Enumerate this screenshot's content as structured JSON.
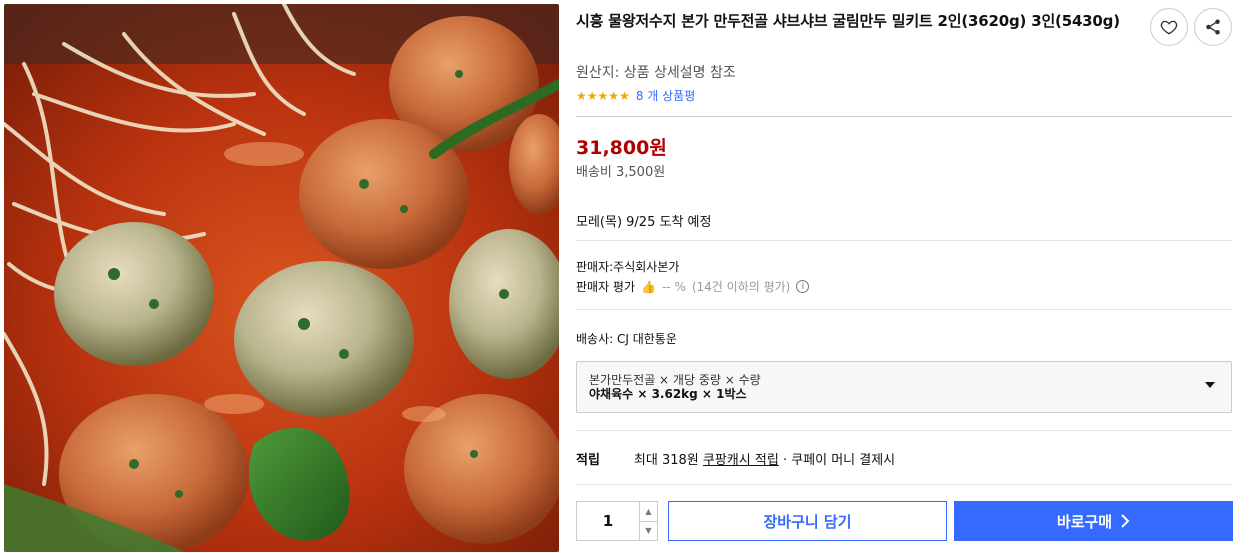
{
  "product": {
    "title": "시흥 물왕저수지 본가 만두전골 샤브샤브 굴림만두 밀키트 2인(3620g) 3인(5430g)",
    "origin": "원산지: 상품 상세설명 참조",
    "rating_stars": 5,
    "review_text": "8 개 상품평",
    "price": "31,800원",
    "shipping_fee": "배송비 3,500원",
    "arrival": "모레(목) 9/25 도착 예정"
  },
  "seller": {
    "name_line": "판매자:주식회사본가",
    "rating_label": "판매자 평가",
    "rating_value": "-- %",
    "rating_note": "(14건 이하의 평가)",
    "carrier": "배송사:  CJ 대한통운"
  },
  "option": {
    "line1": "본가만두전골 × 개당 중량 × 수량",
    "line2": "야채육수 × 3.62kg × 1박스"
  },
  "cash": {
    "label": "적립",
    "max": "최대 318원",
    "link": "쿠팡캐시 적립",
    "tail": "· 쿠페이 머니 결제시"
  },
  "purchase": {
    "quantity": "1",
    "cart_label": "장바구니 담기",
    "buy_label": "바로구매"
  },
  "colors": {
    "price": "#ae0000",
    "accent": "#346aff",
    "stars": "#f2a600"
  },
  "icons": [
    "heart-icon",
    "share-icon",
    "thumb-up-icon",
    "info-icon",
    "chevron-down-icon",
    "chevron-right-icon"
  ]
}
